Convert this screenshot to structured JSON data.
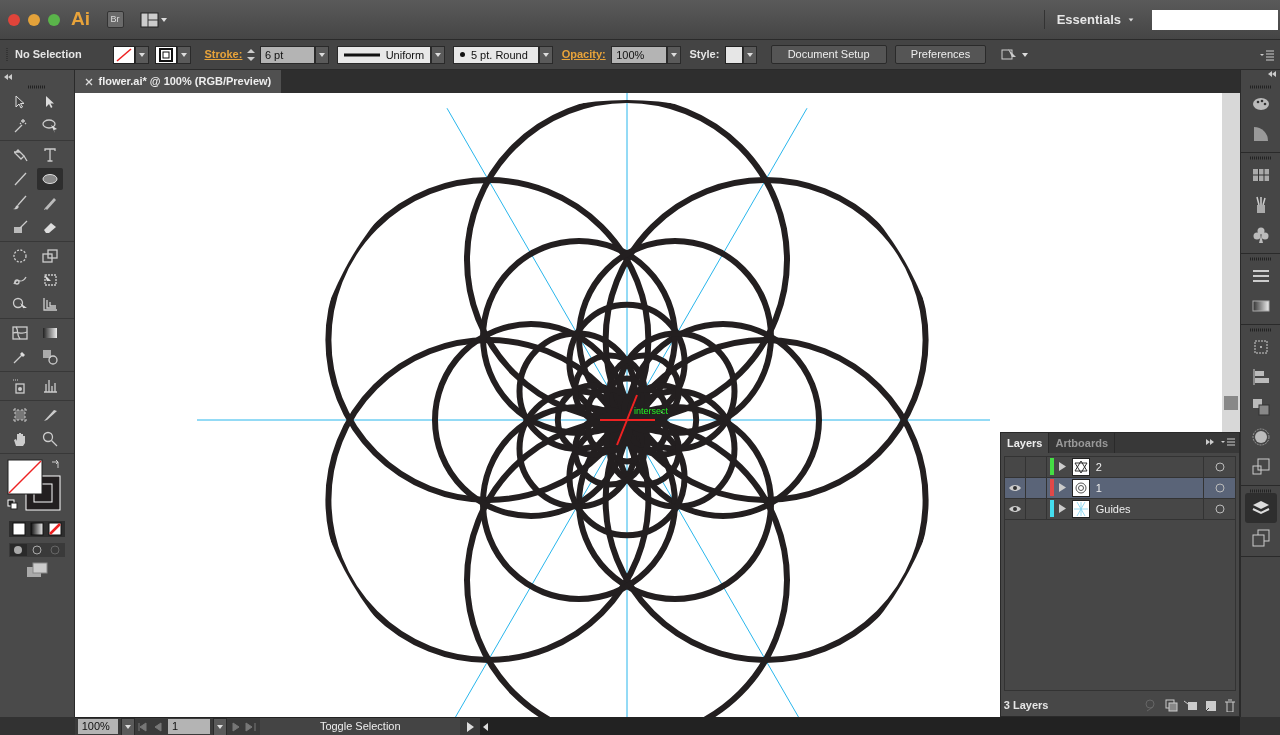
{
  "app_bar": {
    "logo": "Ai",
    "bridge": "Br",
    "workspace": "Essentials"
  },
  "control_bar": {
    "selection": "No Selection",
    "stroke_label": "Stroke:",
    "stroke_weight": "6 pt",
    "profile": "Uniform",
    "brush": "5 pt. Round",
    "opacity_label": "Opacity:",
    "opacity": "100%",
    "style_label": "Style:",
    "buttons": [
      "Document Setup",
      "Preferences"
    ]
  },
  "document_tab": {
    "title": "flower.ai* @ 100% (RGB/Preview)"
  },
  "tool_groups": [
    [
      {
        "kind": "selection",
        "selected": false
      },
      {
        "kind": "direct-selection",
        "selected": false
      },
      {
        "kind": "magic-wand",
        "selected": false
      },
      {
        "kind": "lasso",
        "selected": false
      }
    ],
    [
      {
        "kind": "pen",
        "selected": false
      },
      {
        "kind": "type",
        "selected": false
      },
      {
        "kind": "line",
        "selected": false
      },
      {
        "kind": "ellipse",
        "selected": true
      },
      {
        "kind": "brush",
        "selected": false
      },
      {
        "kind": "pencil",
        "selected": false
      },
      {
        "kind": "blob",
        "selected": false
      },
      {
        "kind": "eraser",
        "selected": false
      }
    ],
    [
      {
        "kind": "rotate",
        "selected": false
      },
      {
        "kind": "scale",
        "selected": false
      },
      {
        "kind": "warp",
        "selected": false
      },
      {
        "kind": "free-transform",
        "selected": false
      },
      {
        "kind": "shape-builder",
        "selected": false
      },
      {
        "kind": "perspective",
        "selected": false
      }
    ],
    [
      {
        "kind": "mesh",
        "selected": false
      },
      {
        "kind": "gradient",
        "selected": false
      },
      {
        "kind": "eyedropper",
        "selected": false
      },
      {
        "kind": "blend",
        "selected": false
      }
    ],
    [
      {
        "kind": "spray",
        "selected": false
      },
      {
        "kind": "graph",
        "selected": false
      }
    ],
    [
      {
        "kind": "artboard",
        "selected": false
      },
      {
        "kind": "slice",
        "selected": false
      },
      {
        "kind": "hand",
        "selected": false
      },
      {
        "kind": "zoom",
        "selected": false
      }
    ]
  ],
  "canvas": {
    "smart_guide_label": "intersect"
  },
  "layers_panel": {
    "tabs": [
      {
        "label": "Layers",
        "selected": true
      },
      {
        "label": "Artboards",
        "selected": false
      }
    ],
    "layers": [
      {
        "name": "2",
        "visible": false,
        "color": "#44dd44",
        "selected": false
      },
      {
        "name": "1",
        "visible": true,
        "color": "#e04848",
        "selected": true
      },
      {
        "name": "Guides",
        "visible": true,
        "color": "#44ddee",
        "selected": false
      }
    ],
    "count": "3 Layers"
  },
  "status_bar": {
    "zoom": "100%",
    "artboard": "1",
    "status": "Toggle Selection"
  }
}
